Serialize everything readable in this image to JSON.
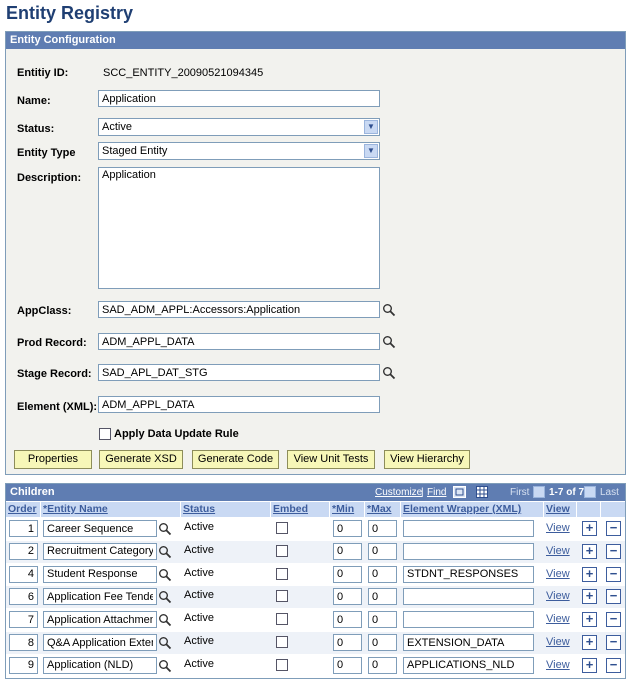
{
  "page": {
    "title": "Entity Registry"
  },
  "config": {
    "header": "Entity Configuration",
    "entity_id_label": "Entitiy ID:",
    "entity_id_value": "SCC_ENTITY_20090521094345",
    "name_label": "Name:",
    "name_value": "Application",
    "status_label": "Status:",
    "status_value": "Active",
    "entity_type_label": "Entity Type",
    "entity_type_value": "Staged Entity",
    "description_label": "Description:",
    "description_value": "Application",
    "appclass_label": "AppClass:",
    "appclass_value": "SAD_ADM_APPL:Accessors:Application",
    "prod_record_label": "Prod Record:",
    "prod_record_value": "ADM_APPL_DATA",
    "stage_record_label": "Stage Record:",
    "stage_record_value": "SAD_APL_DAT_STG",
    "element_label": "Element (XML):",
    "element_value": "ADM_APPL_DATA",
    "apply_rule_label": "Apply Data Update Rule"
  },
  "buttons": {
    "properties": "Properties",
    "generate_xsd": "Generate XSD",
    "generate_code": "Generate Code",
    "view_unit_tests": "View Unit Tests",
    "view_hierarchy": "View Hierarchy"
  },
  "grid": {
    "title": "Children",
    "customize": "Customize",
    "find": "Find",
    "sep": "|",
    "first": "First",
    "range": "1-7 of 7",
    "last": "Last",
    "columns": {
      "order": "Order",
      "entity_name": "*Entity Name",
      "status": "Status",
      "embed": "Embed",
      "min": "*Min",
      "max": "*Max",
      "wrapper": "Element Wrapper (XML)",
      "view": "View"
    },
    "rows": [
      {
        "order": "1",
        "entity_name": "Career Sequence",
        "status": "Active",
        "min": "0",
        "max": "0",
        "wrapper": "",
        "view": "View"
      },
      {
        "order": "2",
        "entity_name": "Recruitment Category",
        "status": "Active",
        "min": "0",
        "max": "0",
        "wrapper": "",
        "view": "View"
      },
      {
        "order": "4",
        "entity_name": "Student Response",
        "status": "Active",
        "min": "0",
        "max": "0",
        "wrapper": "STDNT_RESPONSES",
        "view": "View"
      },
      {
        "order": "6",
        "entity_name": "Application Fee Tender",
        "status": "Active",
        "min": "0",
        "max": "0",
        "wrapper": "",
        "view": "View"
      },
      {
        "order": "7",
        "entity_name": "Application Attachment",
        "status": "Active",
        "min": "0",
        "max": "0",
        "wrapper": "",
        "view": "View"
      },
      {
        "order": "8",
        "entity_name": "Q&A Application Extension",
        "status": "Active",
        "min": "0",
        "max": "0",
        "wrapper": "EXTENSION_DATA",
        "view": "View"
      },
      {
        "order": "9",
        "entity_name": "Application (NLD)",
        "status": "Active",
        "min": "0",
        "max": "0",
        "wrapper": "APPLICATIONS_NLD",
        "view": "View"
      }
    ]
  },
  "icons": {
    "lookup": "magnifier-icon",
    "dropdown": "chevron-down-icon",
    "add": "plus-icon",
    "delete": "minus-icon"
  },
  "colors": {
    "header_bg": "#5f7db2",
    "title": "#1f3f73",
    "button_bg": "#f7f7b8",
    "col_header_bg": "#c9d9f3"
  }
}
